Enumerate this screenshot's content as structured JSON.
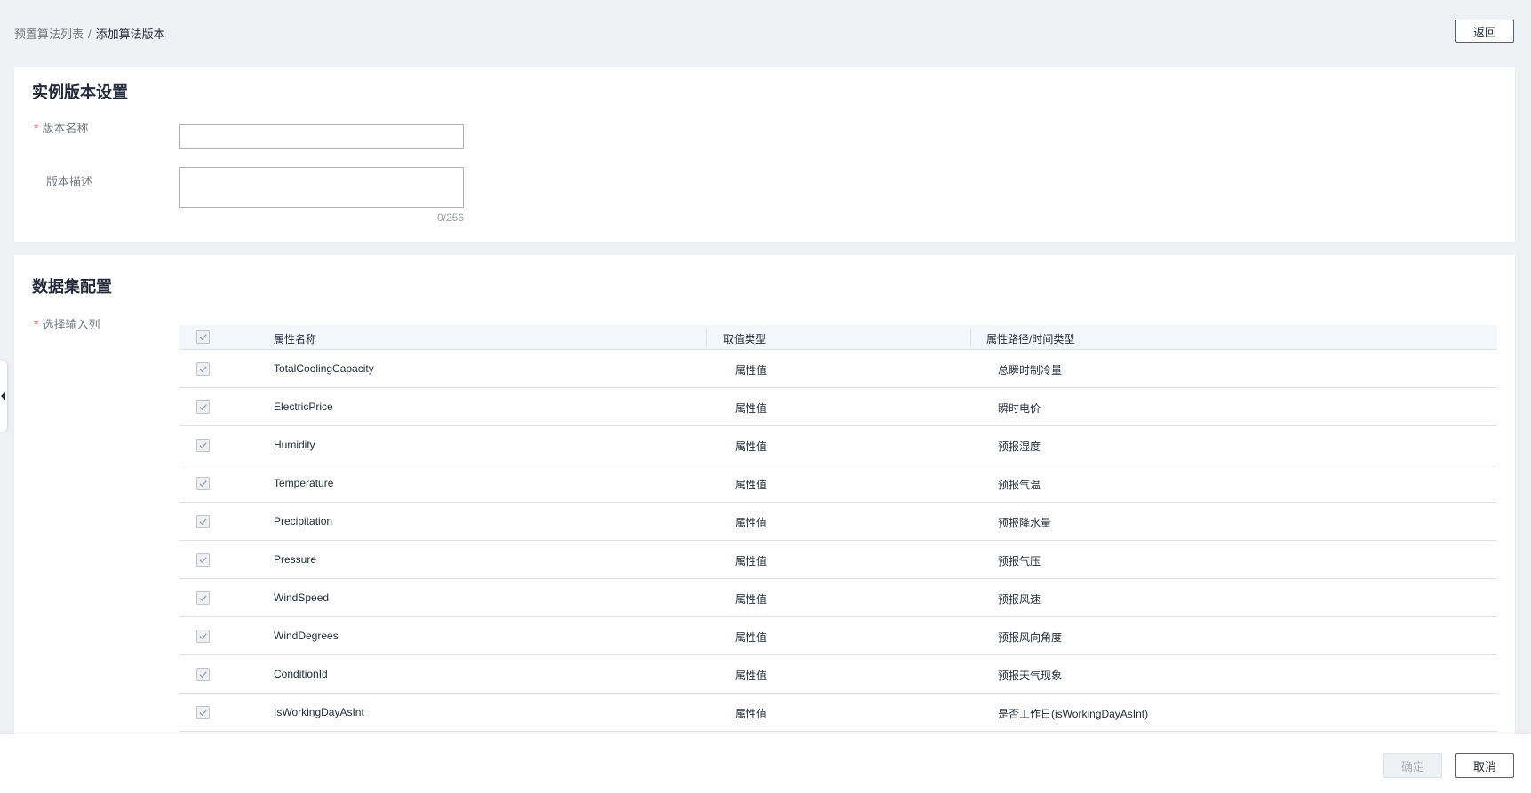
{
  "breadcrumb": {
    "parent": "预置算法列表",
    "separator": "/",
    "current": "添加算法版本"
  },
  "header": {
    "back_label": "返回"
  },
  "instance_section": {
    "title": "实例版本设置",
    "name_label": "版本名称",
    "name_value": "",
    "desc_label": "版本描述",
    "desc_value": "",
    "desc_counter": "0/256",
    "required_mark": "*"
  },
  "dataset_section": {
    "title": "数据集配置",
    "input_cols_label": "选择输入列",
    "required_mark": "*",
    "columns": [
      "属性名称",
      "取值类型",
      "属性路径/时间类型"
    ],
    "rows": [
      {
        "name": "TotalCoolingCapacity",
        "type": "属性值",
        "path": "总瞬时制冷量",
        "checked": true
      },
      {
        "name": "ElectricPrice",
        "type": "属性值",
        "path": "瞬时电价",
        "checked": true
      },
      {
        "name": "Humidity",
        "type": "属性值",
        "path": "预报湿度",
        "checked": true
      },
      {
        "name": "Temperature",
        "type": "属性值",
        "path": "预报气温",
        "checked": true
      },
      {
        "name": "Precipitation",
        "type": "属性值",
        "path": "预报降水量",
        "checked": true
      },
      {
        "name": "Pressure",
        "type": "属性值",
        "path": "预报气压",
        "checked": true
      },
      {
        "name": "WindSpeed",
        "type": "属性值",
        "path": "预报风速",
        "checked": true
      },
      {
        "name": "WindDegrees",
        "type": "属性值",
        "path": "预报风向角度",
        "checked": true
      },
      {
        "name": "ConditionId",
        "type": "属性值",
        "path": "预报天气现象",
        "checked": true
      },
      {
        "name": "IsWorkingDayAsInt",
        "type": "属性值",
        "path": "是否工作日(isWorkingDayAsInt)",
        "checked": true
      }
    ]
  },
  "footer": {
    "confirm_label": "确定",
    "cancel_label": "取消"
  },
  "colors": {
    "required": "#f66f6a",
    "header_bg": "#f3f6fd",
    "page_bg": "#f0f1f5"
  }
}
